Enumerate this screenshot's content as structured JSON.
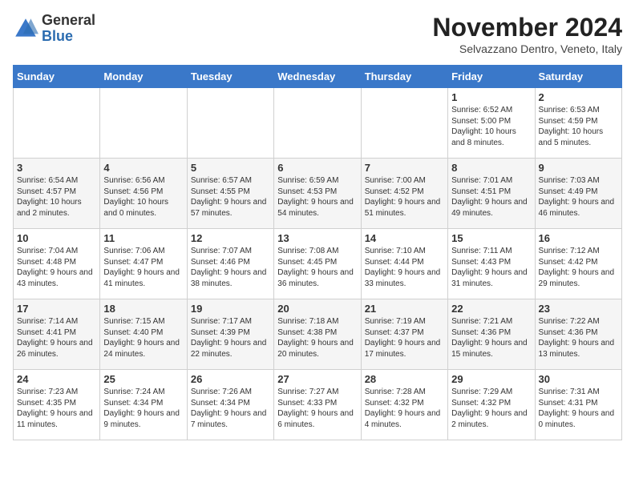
{
  "header": {
    "logo": {
      "general": "General",
      "blue": "Blue"
    },
    "title": "November 2024",
    "subtitle": "Selvazzano Dentro, Veneto, Italy"
  },
  "weekdays": [
    "Sunday",
    "Monday",
    "Tuesday",
    "Wednesday",
    "Thursday",
    "Friday",
    "Saturday"
  ],
  "weeks": [
    [
      {
        "day": "",
        "info": ""
      },
      {
        "day": "",
        "info": ""
      },
      {
        "day": "",
        "info": ""
      },
      {
        "day": "",
        "info": ""
      },
      {
        "day": "",
        "info": ""
      },
      {
        "day": "1",
        "info": "Sunrise: 6:52 AM\nSunset: 5:00 PM\nDaylight: 10 hours and 8 minutes."
      },
      {
        "day": "2",
        "info": "Sunrise: 6:53 AM\nSunset: 4:59 PM\nDaylight: 10 hours and 5 minutes."
      }
    ],
    [
      {
        "day": "3",
        "info": "Sunrise: 6:54 AM\nSunset: 4:57 PM\nDaylight: 10 hours and 2 minutes."
      },
      {
        "day": "4",
        "info": "Sunrise: 6:56 AM\nSunset: 4:56 PM\nDaylight: 10 hours and 0 minutes."
      },
      {
        "day": "5",
        "info": "Sunrise: 6:57 AM\nSunset: 4:55 PM\nDaylight: 9 hours and 57 minutes."
      },
      {
        "day": "6",
        "info": "Sunrise: 6:59 AM\nSunset: 4:53 PM\nDaylight: 9 hours and 54 minutes."
      },
      {
        "day": "7",
        "info": "Sunrise: 7:00 AM\nSunset: 4:52 PM\nDaylight: 9 hours and 51 minutes."
      },
      {
        "day": "8",
        "info": "Sunrise: 7:01 AM\nSunset: 4:51 PM\nDaylight: 9 hours and 49 minutes."
      },
      {
        "day": "9",
        "info": "Sunrise: 7:03 AM\nSunset: 4:49 PM\nDaylight: 9 hours and 46 minutes."
      }
    ],
    [
      {
        "day": "10",
        "info": "Sunrise: 7:04 AM\nSunset: 4:48 PM\nDaylight: 9 hours and 43 minutes."
      },
      {
        "day": "11",
        "info": "Sunrise: 7:06 AM\nSunset: 4:47 PM\nDaylight: 9 hours and 41 minutes."
      },
      {
        "day": "12",
        "info": "Sunrise: 7:07 AM\nSunset: 4:46 PM\nDaylight: 9 hours and 38 minutes."
      },
      {
        "day": "13",
        "info": "Sunrise: 7:08 AM\nSunset: 4:45 PM\nDaylight: 9 hours and 36 minutes."
      },
      {
        "day": "14",
        "info": "Sunrise: 7:10 AM\nSunset: 4:44 PM\nDaylight: 9 hours and 33 minutes."
      },
      {
        "day": "15",
        "info": "Sunrise: 7:11 AM\nSunset: 4:43 PM\nDaylight: 9 hours and 31 minutes."
      },
      {
        "day": "16",
        "info": "Sunrise: 7:12 AM\nSunset: 4:42 PM\nDaylight: 9 hours and 29 minutes."
      }
    ],
    [
      {
        "day": "17",
        "info": "Sunrise: 7:14 AM\nSunset: 4:41 PM\nDaylight: 9 hours and 26 minutes."
      },
      {
        "day": "18",
        "info": "Sunrise: 7:15 AM\nSunset: 4:40 PM\nDaylight: 9 hours and 24 minutes."
      },
      {
        "day": "19",
        "info": "Sunrise: 7:17 AM\nSunset: 4:39 PM\nDaylight: 9 hours and 22 minutes."
      },
      {
        "day": "20",
        "info": "Sunrise: 7:18 AM\nSunset: 4:38 PM\nDaylight: 9 hours and 20 minutes."
      },
      {
        "day": "21",
        "info": "Sunrise: 7:19 AM\nSunset: 4:37 PM\nDaylight: 9 hours and 17 minutes."
      },
      {
        "day": "22",
        "info": "Sunrise: 7:21 AM\nSunset: 4:36 PM\nDaylight: 9 hours and 15 minutes."
      },
      {
        "day": "23",
        "info": "Sunrise: 7:22 AM\nSunset: 4:36 PM\nDaylight: 9 hours and 13 minutes."
      }
    ],
    [
      {
        "day": "24",
        "info": "Sunrise: 7:23 AM\nSunset: 4:35 PM\nDaylight: 9 hours and 11 minutes."
      },
      {
        "day": "25",
        "info": "Sunrise: 7:24 AM\nSunset: 4:34 PM\nDaylight: 9 hours and 9 minutes."
      },
      {
        "day": "26",
        "info": "Sunrise: 7:26 AM\nSunset: 4:34 PM\nDaylight: 9 hours and 7 minutes."
      },
      {
        "day": "27",
        "info": "Sunrise: 7:27 AM\nSunset: 4:33 PM\nDaylight: 9 hours and 6 minutes."
      },
      {
        "day": "28",
        "info": "Sunrise: 7:28 AM\nSunset: 4:32 PM\nDaylight: 9 hours and 4 minutes."
      },
      {
        "day": "29",
        "info": "Sunrise: 7:29 AM\nSunset: 4:32 PM\nDaylight: 9 hours and 2 minutes."
      },
      {
        "day": "30",
        "info": "Sunrise: 7:31 AM\nSunset: 4:31 PM\nDaylight: 9 hours and 0 minutes."
      }
    ]
  ]
}
